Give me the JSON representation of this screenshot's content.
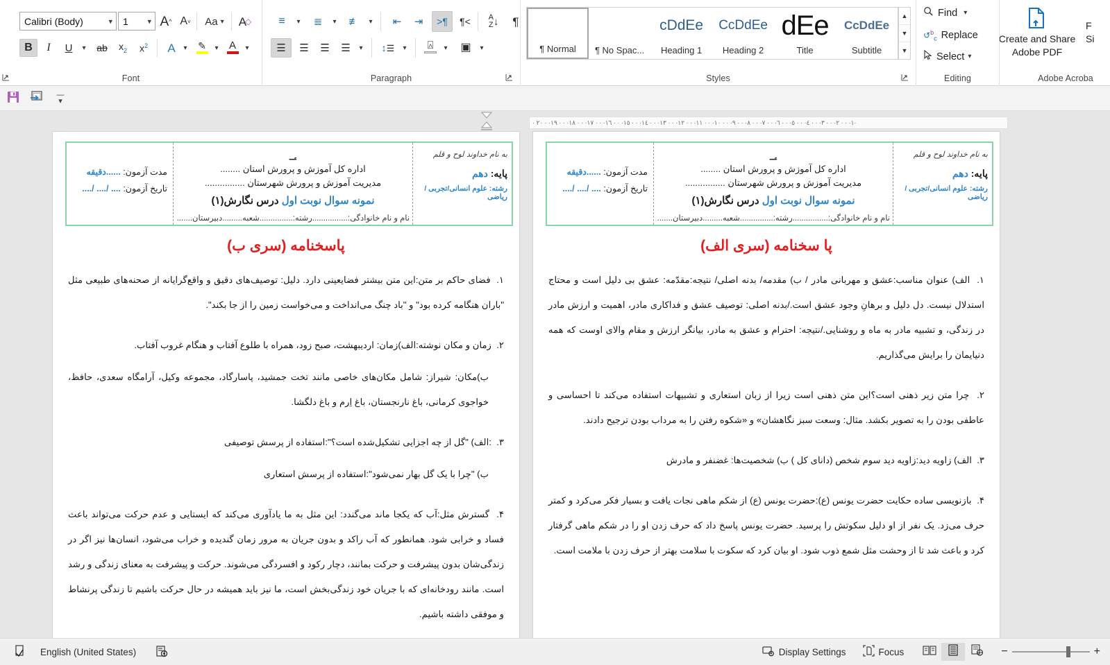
{
  "ribbon": {
    "groups": [
      {
        "name": "Font",
        "label": "Font"
      },
      {
        "name": "Paragraph",
        "label": "Paragraph"
      },
      {
        "name": "Styles",
        "label": "Styles"
      },
      {
        "name": "Editing",
        "label": "Editing"
      },
      {
        "name": "Adobe Acrobat",
        "label": "Adobe Acroba"
      }
    ],
    "font": {
      "family_value": "Calibri (Body)",
      "size_value": "1",
      "grow_font": "A^",
      "shrink_font": "Av",
      "change_case": "Aa",
      "clear_formatting": "clear-formatting-icon",
      "bold": "B",
      "italic": "I",
      "underline": "U",
      "strikethrough": "ab",
      "subscript": "x2",
      "superscript": "x2",
      "text_effects": "A",
      "highlight": "highlight-icon",
      "font_color": "A"
    },
    "paragraph": {
      "bullets": "bullet-list-icon",
      "numbering": "numbered-list-icon",
      "multilevel": "multilevel-list-icon",
      "decrease_indent": "decrease-indent-icon",
      "increase_indent": "increase-indent-icon",
      "ltr": "»¶",
      "rtl": "¶«",
      "sort": "AZ",
      "show_marks": "¶",
      "align_left": "align-left-icon",
      "align_center": "align-center-icon",
      "align_right": "align-right-icon",
      "justify": "justify-icon",
      "line_spacing": "line-spacing-icon",
      "shading": "shading-icon",
      "borders": "borders-icon"
    },
    "styles": {
      "items": [
        {
          "preview": "",
          "name": "¶ Normal",
          "kind": "normal",
          "selected": true
        },
        {
          "preview": "",
          "name": "¶ No Spac...",
          "kind": "nospace",
          "selected": false
        },
        {
          "preview": "cDdEe",
          "name": "Heading 1",
          "kind": "h1",
          "selected": false
        },
        {
          "preview": "CcDdEe",
          "name": "Heading 2",
          "kind": "h2",
          "selected": false
        },
        {
          "preview": "dEe",
          "name": "Title",
          "kind": "title",
          "selected": false
        },
        {
          "preview": "CcDdEe",
          "name": "Subtitle",
          "kind": "sub",
          "selected": false
        }
      ]
    },
    "editing": {
      "find": "Find",
      "replace": "Replace",
      "select": "Select"
    },
    "acrobat": {
      "line1": "Create and Share",
      "line2": "Adobe PDF",
      "partial_right_1": "F",
      "partial_right_2": "Si"
    }
  },
  "qat": {
    "save": "save-icon",
    "print_preview": "print-preview-icon",
    "customize": "customize-quick-access-icon"
  },
  "ruler": {
    "horizontal_ticks": "· ١· · · ٢· · · ٣· · · ٤· · · ٥· · · ٦· · · ٧· · · ٨· · · ٩· · · ١٠· · · ١١· · · ١٢· · · ١٣· · · ١٤· · · ١٥· · · ١٦· · · ١٧· · · ١٨· · · ١٩· · ٢٠·"
  },
  "document": {
    "header_box": {
      "bismillah": "به نام خداوند لوح و قلم",
      "grade_label": "پایه:",
      "grade_value": "دهم",
      "field_label": "رشته:",
      "field_value": "علوم انسانی/تجربی /ریاضی",
      "emblem": "emblem-iran-icon",
      "org_line1": "اداره کل آموزش و پرورش استان ........",
      "org_line2": "مدیریت آموزش و پرورش شهرستان ................",
      "exam_title_a": "نمونه سوال نوبت اول",
      "exam_title_b": "درس نگارش(۱)",
      "name_line": "نام و نام خانوادگی:................رشته:...............شعبه.........دبیرستان.........",
      "duration_label": "مدت آزمون:",
      "duration_value": "......دقیقه",
      "date_label": "تاریخ آزمون:",
      "date_value": ".... /.... /...."
    },
    "page_right": {
      "title": "پا سخنامه (سری الف)",
      "items": [
        {
          "num": "۱.",
          "paras": [
            "الف) عنوان مناسب:عشق و مهربانی مادر / ب) مقدمه/ بدنه اصلی/ نتیجه:مقدّمه: عشق بی دلیل است و محتاج استدلال نیست. دل دلیل و برهانِ وجود عشق است./بدنه اصلی: توصیف عشق و فداکاری مادر، اهمیت و ارزش مادر در زندگی، و تشبیه مادر به ماه و روشنایی./نتیجه: احترام و عشق به مادر، بیانگر ارزش و مقام والای اوست که همه دنیایمان را برایش می‌گذاریم."
          ]
        },
        {
          "num": "۲.",
          "paras": [
            "چرا متن زیر ذهنی است؟این متن ذهنی است زیرا از زبان استعاری و تشبیهات استفاده می‌کند تا احساسی و عاطفی بودن را به تصویر بکشد. مثال:  وسعت سبز نگاهشان» و «شکوه رفتن را به مرداب بودن ترجیح دادند."
          ]
        },
        {
          "num": "۳.",
          "paras": [
            "الف) زاویه دید:زاویه دید سوم شخص (دانای کل )  ب) شخصیت‌ها: غضنفر و مادرش"
          ]
        },
        {
          "num": "۴.",
          "paras": [
            "بازنویسی ساده حکایت حضرت یونس (ع):حضرت یونس (ع) از شکم ماهی نجات یافت و بسیار فکر می‌کرد و کمتر حرف می‌زد. یک نفر از او دلیل سکوتش را پرسید. حضرت یونس پاسخ داد که حرف زدن او را در شکم ماهی گرفتار کرد و باعث شد تا از وحشت مثل شمع ذوب شود. او بیان کرد که سکوت با سلامت بهتر از حرف زدن با ملامت است."
          ]
        }
      ]
    },
    "page_left": {
      "title": "پاسخنامه (سری ب)",
      "items": [
        {
          "num": "۱.",
          "paras": [
            "فضای حاکم بر متن:این متن بیشتر فضایعینی دارد. دلیل: توصیف‌های دقیق و واقع‌گرایانه از صحنه‌های طبیعی مثل \"باران هنگامه کرده بود\" و \"باد چنگ می‌انداخت و می‌خواست زمین را از جا بکند\"."
          ]
        },
        {
          "num": "۲.",
          "paras": [
            "زمان و مکان نوشته:الف)زمان: اردیبهشت، صبح زود، همراه با طلوع آفتاب و هنگام غروب آفتاب.",
            "ب)مکان: شیراز: شامل مکان‌های خاصی مانند تخت جمشید، پاسارگاد، مجموعه وکیل، آرامگاه سعدی، حافظ، خواجوی کرمانی، باغ نارنجستان، باغ اِرم و باغ دلگشا."
          ]
        },
        {
          "num": "۳.",
          "paras": [
            ":الف) \"گل از چه اجزایی تشکیل‌شده است؟\":استفاده از پرسش توصیفی",
            "ب) \"چرا با یک گل بهار نمی‌شود\":استفاده از پرسش استعاری"
          ]
        },
        {
          "num": "۴.",
          "paras": [
            "گسترش مثل:آب که یکجا ماند می‌گندد: این مثل به ما یادآوری می‌کند که ایستایی و عدم حرکت می‌تواند باعث فساد و خرابی شود. همانطور که آب راکد و بدون جریان به مرور زمان گندیده و خراب می‌شود، انسان‌ها نیز اگر در زندگی‌شان بدون پیشرفت و حرکت بمانند، دچار رکود و افسردگی می‌شوند. حرکت و پیشرفت به معنای زندگی و رشد است. مانند رودخانه‌ای که با جریان خود زندگی‌بخش است، ما نیز باید همیشه در حال حرکت باشیم تا زندگی پرنشاط و موفقی داشته باشیم."
          ]
        }
      ]
    }
  },
  "statusbar": {
    "language": "English (United States)",
    "proofing_icon": "proofing-errors-icon",
    "accessibility_icon": "accessibility-checker-icon",
    "display_settings": "Display Settings",
    "focus": "Focus",
    "view_read": "read-mode-icon",
    "view_print": "print-layout-icon",
    "view_web": "web-layout-icon",
    "zoom_out": "−",
    "zoom_in": "+"
  },
  "colors": {
    "accent_blue": "#2e86c8",
    "title_red": "#e02020",
    "box_green": "#86d6a8",
    "ribbon_bg": "#ffffff",
    "workspace_bg": "#e6e6e6"
  }
}
